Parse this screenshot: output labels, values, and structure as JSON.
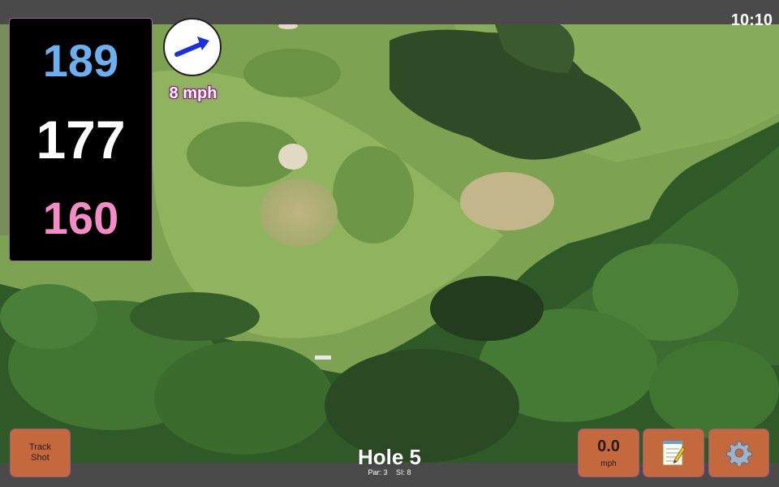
{
  "status": {
    "time": "10:10"
  },
  "yardages": {
    "back": "189",
    "center": "177",
    "front": "160"
  },
  "wind": {
    "speed_label": "8 mph"
  },
  "buttons": {
    "track_shot_line1": "Track",
    "track_shot_line2": "Shot",
    "speed_value": "0.0",
    "speed_unit": "mph"
  },
  "hole": {
    "title": "Hole 5",
    "par": "Par: 3",
    "si": "SI: 8"
  },
  "icons": {
    "wind": "arrow-icon",
    "notes": "notepad-icon",
    "settings": "gear-icon"
  },
  "colors": {
    "back_yardage": "#6cb0f2",
    "center_yardage": "#ffffff",
    "front_yardage": "#f68cc6",
    "button": "#c4683e"
  }
}
